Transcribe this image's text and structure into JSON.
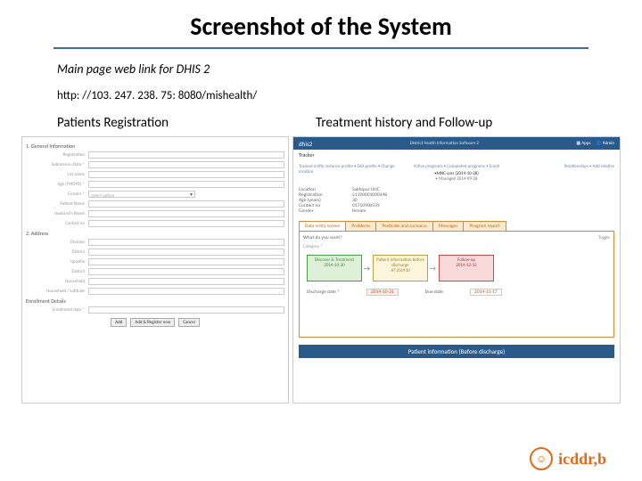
{
  "title": "Screenshot of the System",
  "subtitle": "Main page web link for DHIS 2",
  "url": "http: //103. 247. 238. 75: 8080/mishealth/",
  "labels": {
    "left": "Patients Registration",
    "right": "Treatment history and Follow-up"
  },
  "leftForm": {
    "sec1": "1. General Information",
    "fields1": [
      "Registration",
      "Submission Date *",
      "List name",
      "Age (YMDYD) *",
      "Gender *",
      "Patient Name",
      "Husband's Name",
      "Contact no"
    ],
    "genderPlaceholder": "select option",
    "sec2": "2. Address",
    "fields2": [
      "Division",
      "District",
      "Upazilla",
      "District",
      "Household",
      "Household / Latitude"
    ],
    "sec3": "Enrollment Details",
    "enroll": "Enrollment date *",
    "buttons": [
      "Add",
      "Add & Register new",
      "Cancel"
    ]
  },
  "right": {
    "brand": "dhis2",
    "brandSub": "District Health Information Software 2",
    "apps": "Apps",
    "user": "Admin",
    "nav": "Tracker",
    "crumbsL": "Tracked entity instance profile • Edit profile • Change location",
    "crumbsM": "Active programs • Completed programs • Enroll",
    "crumbsR": "Relationships • Add relative",
    "activeProg": "•MNC-sars (2014-10-28)",
    "managed": "• Managed 2014-09-28",
    "info": [
      {
        "k": "Location",
        "v": "Sakhipur UHC"
      },
      {
        "k": "Registration",
        "v": "51190001000348"
      },
      {
        "k": "Age (years)",
        "v": "30"
      },
      {
        "k": "Contact no",
        "v": "01710900559"
      },
      {
        "k": "Gender",
        "v": "female"
      }
    ],
    "tabs": [
      "Data entry screen",
      "Problems",
      "Pesticide and socioeco",
      "Messages",
      "Program report"
    ],
    "question": "What do you want?",
    "category": "Category *",
    "stages": [
      {
        "label": "Discover & Treatment",
        "date": "2014-10-30",
        "cls": "g"
      },
      {
        "label": "Patient Information before discharge",
        "date": "AT 201410",
        "cls": "y"
      },
      {
        "label": "Follow-up",
        "date": "2014-12-15",
        "cls": "r"
      }
    ],
    "dischargeLabel": "Discharge date *",
    "dischargeVal": "2014-10-31",
    "dueLabel": "Due date",
    "dueVal": "2014-11-17",
    "toggle": "Toggle",
    "infoBand": "Patient information (Before discharge)"
  },
  "logoText": "icddr,b"
}
